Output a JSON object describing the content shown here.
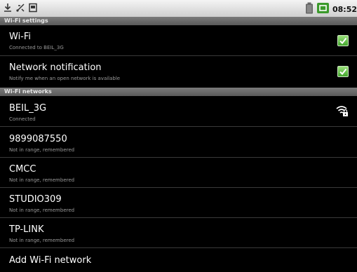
{
  "status_bar": {
    "time": "08:52",
    "icons": [
      "download-icon",
      "usb-debug-icon",
      "sd-card-icon",
      "battery-icon",
      "signal-icon"
    ]
  },
  "sections": {
    "wifi_settings": "Wi-Fi settings",
    "wifi_networks": "Wi-Fi networks"
  },
  "settings": [
    {
      "title": "Wi-Fi",
      "subtitle": "Connected to BEIL_3G",
      "checked": true
    },
    {
      "title": "Network notification",
      "subtitle": "Notify me when an open network is available",
      "checked": true
    }
  ],
  "networks": [
    {
      "name": "BEIL_3G",
      "status": "Connected",
      "icon": "wifi-locked-icon"
    },
    {
      "name": "9899087550",
      "status": "Not in range, remembered"
    },
    {
      "name": "CMCC",
      "status": "Not in range, remembered"
    },
    {
      "name": "STUDIO309",
      "status": "Not in range, remembered"
    },
    {
      "name": "TP-LINK",
      "status": "Not in range, remembered"
    }
  ],
  "add_network": "Add Wi-Fi network",
  "colors": {
    "accent_check": "#43a62e",
    "section_bg": "#666666"
  }
}
